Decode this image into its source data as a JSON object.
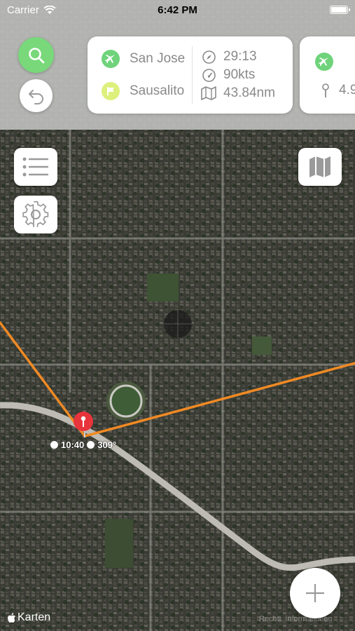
{
  "status_bar": {
    "carrier": "Carrier",
    "time": "6:42 PM"
  },
  "route_card": {
    "origin": "San Jose",
    "destination": "Sausalito",
    "duration": "29:13",
    "speed": "90kts",
    "distance": "43.84nm"
  },
  "second_card": {
    "partial_value": "4.9"
  },
  "map_marker": {
    "time": "10:40",
    "heading": "309°"
  },
  "attribution": {
    "brand": "Karten",
    "legal": "Rechtl. Informationen"
  },
  "colors": {
    "accent_green": "#78d87a",
    "route_line": "#f08a24",
    "marker_red": "#e8343b"
  },
  "icons": [
    "search-icon",
    "undo-icon",
    "plane-icon",
    "flag-icon",
    "clock-icon",
    "speedometer-icon",
    "map-icon",
    "pin-icon",
    "list-icon",
    "gear-icon",
    "map-layers-icon",
    "plus-icon",
    "apple-icon"
  ]
}
